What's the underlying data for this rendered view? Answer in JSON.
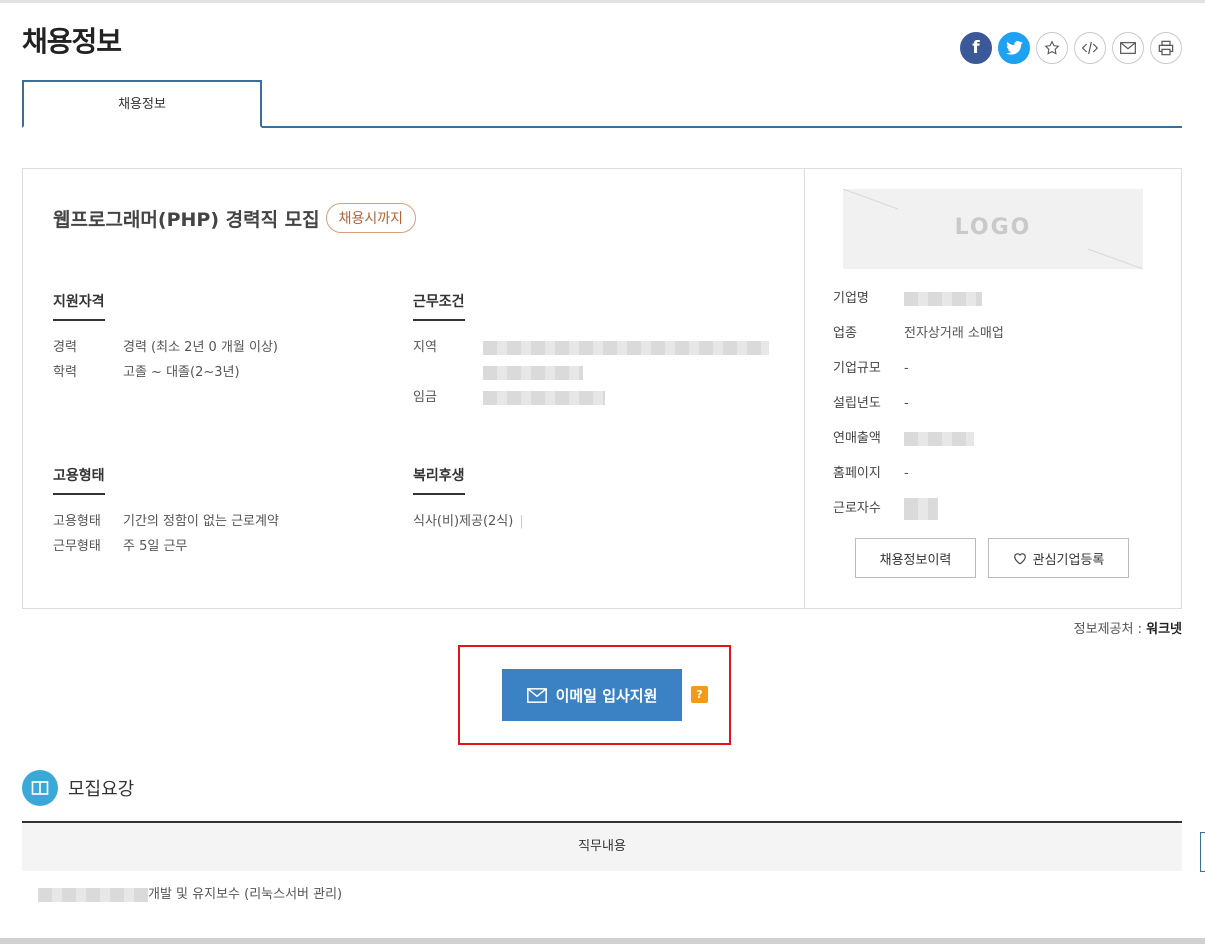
{
  "header": {
    "title": "채용정보",
    "share_icons": [
      "facebook-icon",
      "twitter-icon",
      "star-icon",
      "code-icon",
      "mail-icon",
      "print-icon"
    ]
  },
  "tabs": [
    {
      "label": "채용정보",
      "active": true
    }
  ],
  "job": {
    "title": "웹프로그래머(PHP) 경력직 모집",
    "deadline_badge": "채용시까지",
    "qualification": {
      "heading": "지원자격",
      "rows": [
        {
          "key": "경력",
          "value": "경력 (최소 2년 0 개월 이상)"
        },
        {
          "key": "학력",
          "value": "고졸 ~ 대졸(2~3년)"
        }
      ]
    },
    "conditions": {
      "heading": "근무조건",
      "rows": [
        {
          "key": "지역",
          "value": ""
        },
        {
          "key": "임금",
          "value": ""
        }
      ]
    },
    "employment": {
      "heading": "고용형태",
      "rows": [
        {
          "key": "고용형태",
          "value": "기간의 정함이 없는 근로계약"
        },
        {
          "key": "근무형태",
          "value": "주 5일 근무"
        }
      ]
    },
    "welfare": {
      "heading": "복리후생",
      "value": "식사(비)제공(2식)"
    }
  },
  "company": {
    "logo_text": "LOGO",
    "rows": [
      {
        "key": "기업명",
        "value": ""
      },
      {
        "key": "업종",
        "value": "전자상거래 소매업"
      },
      {
        "key": "기업규모",
        "value": "-"
      },
      {
        "key": "설립년도",
        "value": "-"
      },
      {
        "key": "연매출액",
        "value": ""
      },
      {
        "key": "홈페이지",
        "value": "-"
      },
      {
        "key": "근로자수",
        "value": ""
      }
    ],
    "history_button": "채용정보이력",
    "favorite_button": "관심기업등록"
  },
  "source": {
    "label": "정보제공처 :",
    "name": "워크넷"
  },
  "apply": {
    "button": "이메일 입사지원",
    "help": "?"
  },
  "recruit": {
    "title": "모집요강",
    "column": "직무내용",
    "duty": "개발 및 유지보수 (리눅스서버 관리)"
  },
  "colors": {
    "accent": "#3b82c4",
    "tab_border": "#3a6f9c",
    "highlight": "#e0151b",
    "help": "#f39a1b"
  }
}
